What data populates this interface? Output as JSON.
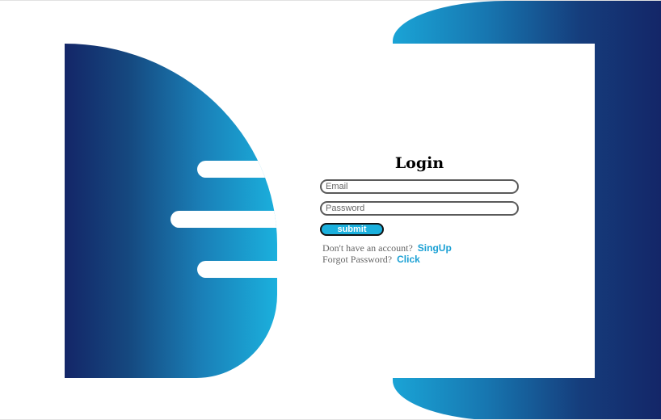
{
  "login": {
    "title": "Login",
    "email_placeholder": "Email",
    "password_placeholder": "Password",
    "submit_label": "submit",
    "signup_prompt": "Don't have an account?",
    "signup_link": "SingUp",
    "forgot_prompt": "Forgot Password?",
    "forgot_link": "Click"
  },
  "colors": {
    "gradient_dark": "#142668",
    "gradient_light": "#1bb0dd",
    "link": "#1aa0d4"
  }
}
